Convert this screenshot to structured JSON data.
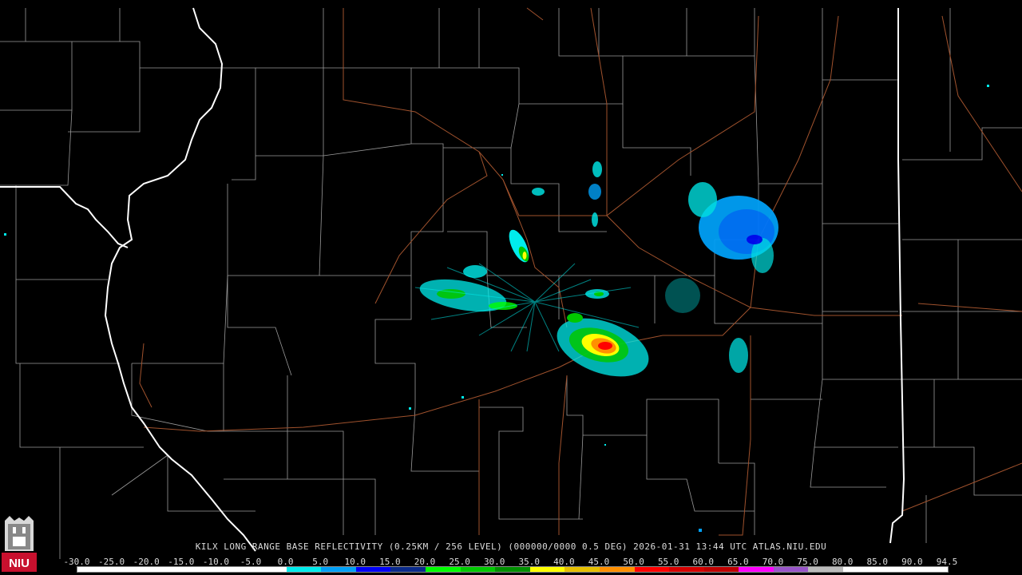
{
  "product": {
    "title": "KILX LONG RANGE BASE REFLECTIVITY (0.25KM / 256 LEVEL) (000000/0000 0.5 DEG) 2026-01-31 13:44 UTC  ATLAS.NIU.EDU"
  },
  "logo": {
    "text": "NIU",
    "accent": "#c8102e"
  },
  "colors": {
    "background": "#000000",
    "county_lines": "#9a9a9a",
    "state_lines": "#ffffff",
    "roads": "#a0522d"
  },
  "legend": {
    "labels": [
      "-30.0",
      "-25.0",
      "-20.0",
      "-15.0",
      "-10.0",
      "-5.0",
      "0.0",
      "5.0",
      "10.0",
      "15.0",
      "20.0",
      "25.0",
      "30.0",
      "35.0",
      "40.0",
      "45.0",
      "50.0",
      "55.0",
      "60.0",
      "65.0",
      "70.0",
      "75.0",
      "80.0",
      "85.0",
      "90.0",
      "94.5"
    ],
    "colors": [
      "#ffffff",
      "#ffffff",
      "#ffffff",
      "#ffffff",
      "#ffffff",
      "#ffffff",
      "#00ecec",
      "#01a0f6",
      "#0000f6",
      "#0a2a8a",
      "#00ff00",
      "#00c800",
      "#009000",
      "#ffff00",
      "#e7c000",
      "#ff9000",
      "#ff0000",
      "#d60000",
      "#c00000",
      "#ff00ff",
      "#9955c9",
      "#bbbbbb",
      "#ffffff",
      "#ffffff",
      "#ffffff"
    ]
  }
}
